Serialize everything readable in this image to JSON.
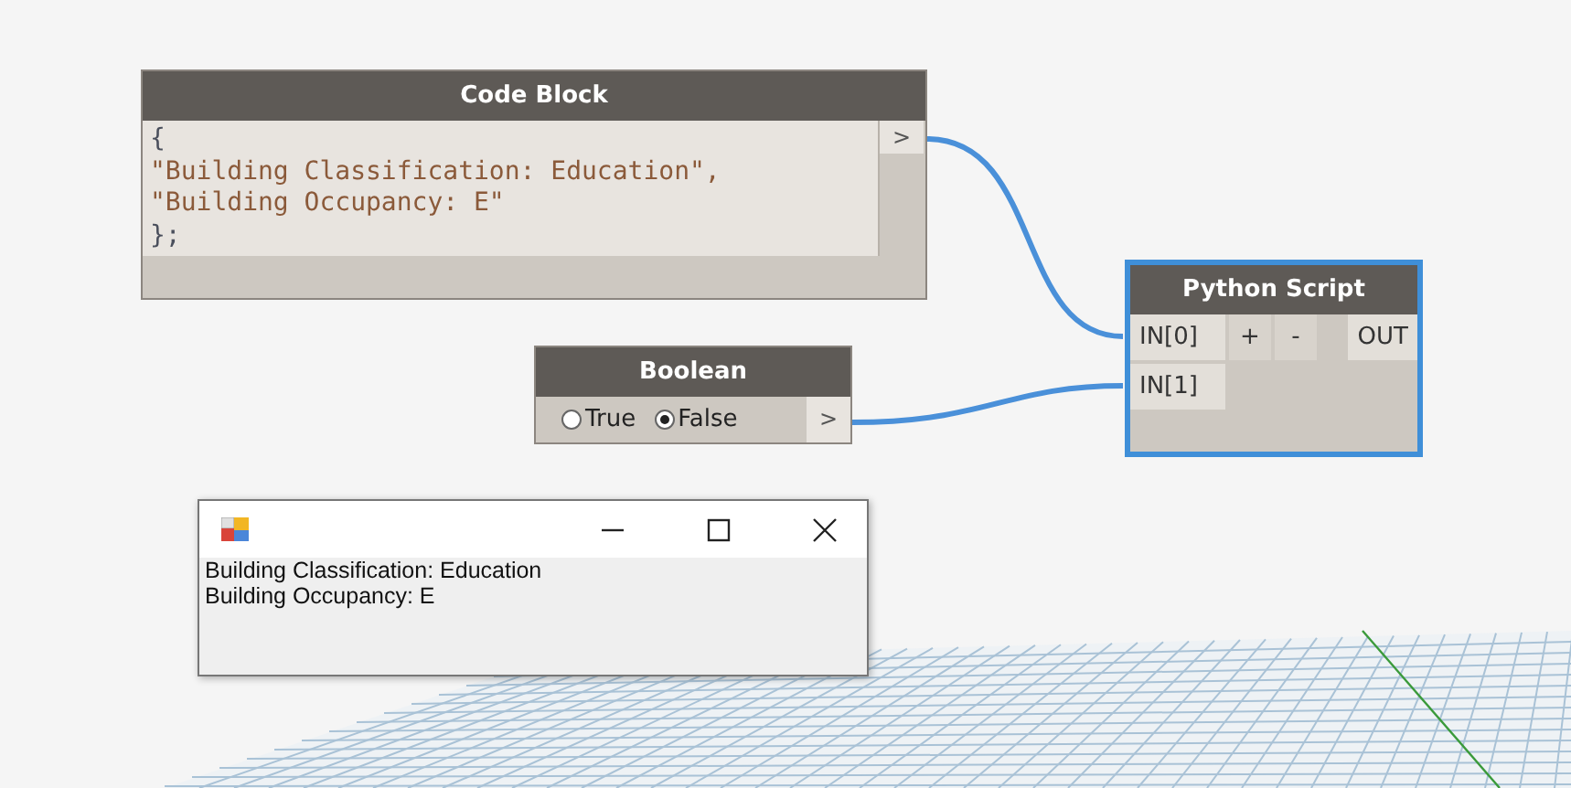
{
  "nodes": [
    {
      "kind": "code",
      "title": "Code Block",
      "selected": false,
      "lines": [
        {
          "kind": "punct",
          "text": "{"
        },
        {
          "kind": "string",
          "text": "\"Building Classification: Education\","
        },
        {
          "kind": "string",
          "text": "\"Building Occupancy: E\""
        },
        {
          "kind": "punct",
          "text": "};"
        }
      ],
      "output": ">"
    },
    {
      "kind": "boolean",
      "title": "Boolean",
      "selected": false,
      "options": [
        {
          "label": "True",
          "selected": false
        },
        {
          "label": "False",
          "selected": true
        }
      ],
      "output": ">"
    },
    {
      "kind": "python",
      "title": "Python Script",
      "selected": true,
      "inputs": [
        "IN[0]",
        "IN[1]"
      ],
      "add": "+",
      "remove": "-",
      "output": "OUT"
    }
  ],
  "dialog": {
    "lines": [
      "Building Classification: Education",
      "Building Occupancy: E"
    ]
  }
}
